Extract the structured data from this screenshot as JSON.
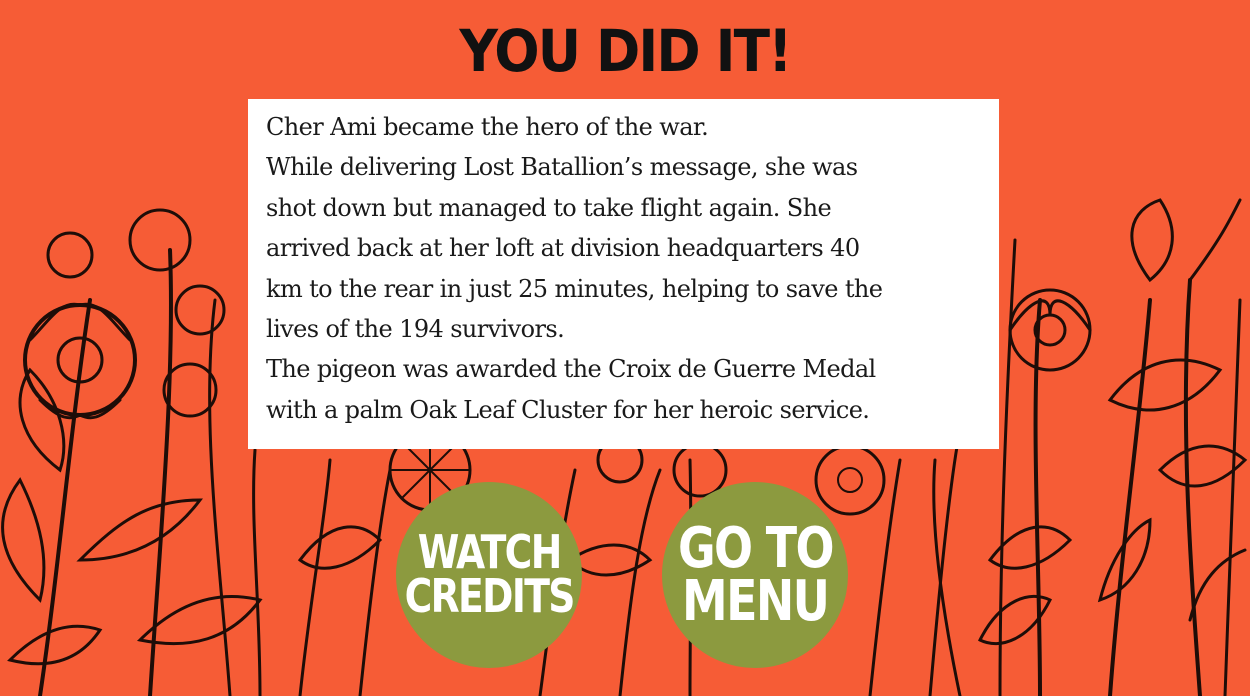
{
  "screen": {
    "title": "YOU DID IT!",
    "background_color": "#f65c36",
    "illustration": "botanical-flowers-line-art"
  },
  "story": {
    "lines": [
      "Cher Ami became the hero of the war.",
      "While delivering Lost Batallion’s message, she was",
      "shot down but managed to take flight again. She",
      "arrived back at her loft at division headquarters 40",
      "km to the rear in just 25 minutes, helping to save the",
      "lives of the 194 survivors.",
      "The pigeon was awarded the Croix de Guerre Medal",
      "with a palm Oak Leaf Cluster for her heroic service."
    ]
  },
  "buttons": {
    "watch_credits": {
      "line1": "WATCH",
      "line2": "CREDITS",
      "color": "#8c9a3f"
    },
    "go_to_menu": {
      "line1": "GO TO",
      "line2": "MENU",
      "color": "#8c9a3f"
    }
  }
}
